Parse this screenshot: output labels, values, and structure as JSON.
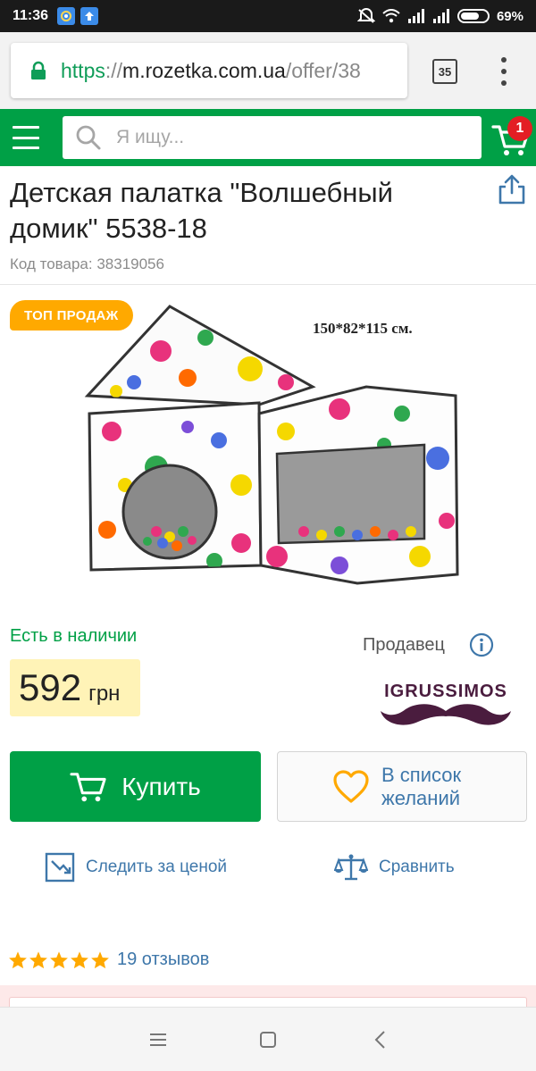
{
  "status_bar": {
    "time": "11:36",
    "battery": "69%"
  },
  "browser": {
    "url_scheme": "https",
    "url_sep": "://",
    "url_host": "m.rozetka.com.ua",
    "url_path": "/offer/38",
    "tab_count": "35"
  },
  "header": {
    "search_placeholder": "Я ищу...",
    "cart_count": "1"
  },
  "product": {
    "title": "Детская палатка \"Волшебный домик\" 5538-18",
    "code": "Код товара: 38319056",
    "badge": "ТОП ПРОДАЖ",
    "image_caption": "150*82*115 см.",
    "availability": "Есть в наличии",
    "price_value": "592",
    "price_currency": "грн",
    "seller_label": "Продавец",
    "seller_logo_text": "IGRUSSIMOS",
    "buy_label": "Купить",
    "wishlist_label": "В список желаний",
    "track_price_label": "Следить за ценой",
    "compare_label": "Сравнить",
    "reviews_label": "19 отзывов",
    "rating": 5
  },
  "colors": {
    "brand_green": "#00a046",
    "link_blue": "#3e77aa",
    "badge_orange": "#ffa900",
    "price_bg": "#fff3b7",
    "cart_badge": "#e31e24",
    "star": "#ffa900"
  },
  "icons": {
    "status": [
      "notification-app-icon",
      "upload-app-icon",
      "mute-icon",
      "wifi-icon",
      "signal-icon",
      "battery-icon"
    ],
    "browser": [
      "lock-icon",
      "tabs-icon",
      "menu-dots-icon"
    ],
    "header": [
      "hamburger-icon",
      "search-icon",
      "cart-icon"
    ],
    "product": [
      "share-icon",
      "info-icon",
      "cart-icon",
      "heart-icon",
      "price-chart-icon",
      "scales-icon",
      "star-icon"
    ],
    "nav": [
      "menu-nav-icon",
      "home-nav-icon",
      "back-nav-icon"
    ]
  }
}
